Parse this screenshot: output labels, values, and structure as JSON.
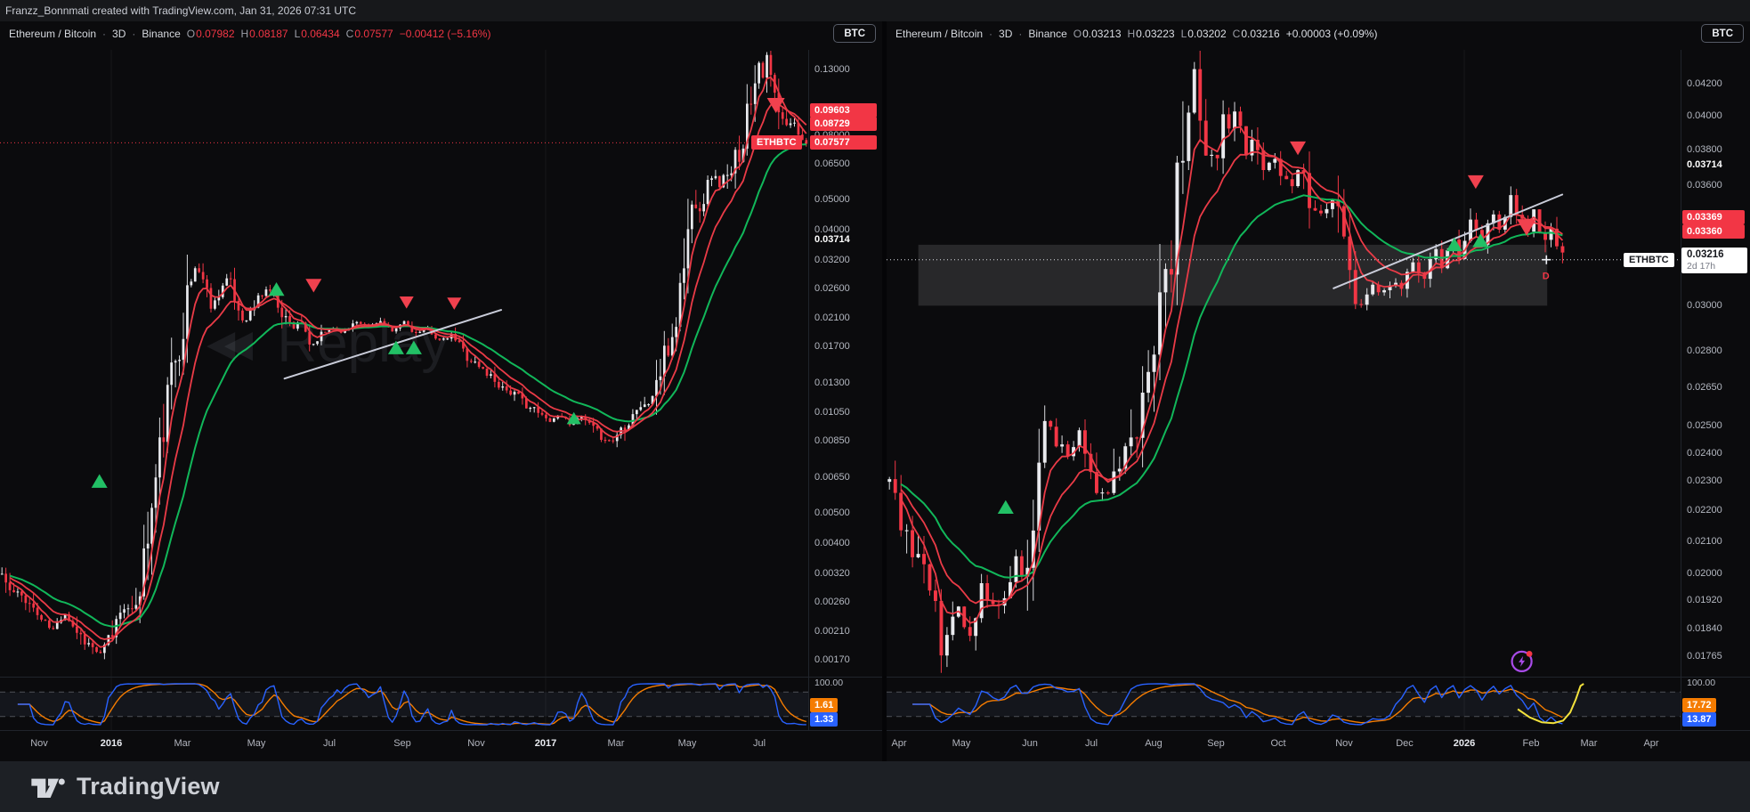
{
  "attribution": "Franzz_Bonnmati created with TradingView.com, Jan 31, 2026 07:31 UTC",
  "ui": {
    "dot": "·",
    "replay_icon": "◀◀"
  },
  "footer": {
    "brand": "TradingView"
  },
  "colors": {
    "red": "#f23645",
    "green_ma": "#11b75a",
    "red_ma": "#ea3b47",
    "up_candle": "#e9eaee",
    "blue": "#2962ff",
    "orange": "#f57c00",
    "yellow": "#f3e23c",
    "purple": "#a84be8",
    "trendline": "#c9ccd9",
    "white_tag_bg": "#ffffff"
  },
  "left_chart": {
    "legend": {
      "title": "Ethereum / Bitcoin",
      "interval": "3D",
      "exchange": "Binance",
      "items": [
        {
          "k": "O",
          "v": "0.07982"
        },
        {
          "k": "H",
          "v": "0.08187"
        },
        {
          "k": "L",
          "v": "0.06434"
        },
        {
          "k": "C",
          "v": "0.07577"
        }
      ],
      "change": "−0.00412 (−5.16%)"
    },
    "currency_button": "BTC",
    "watermark": "Replay",
    "price_scale": {
      "ticks": [
        {
          "label": "0.13000",
          "p": 0.13
        },
        {
          "label": "0.08000",
          "p": 0.08
        },
        {
          "label": "0.06500",
          "p": 0.065
        },
        {
          "label": "0.05000",
          "p": 0.05
        },
        {
          "label": "0.04000",
          "p": 0.04
        },
        {
          "label": "0.03200",
          "p": 0.032
        },
        {
          "label": "0.02600",
          "p": 0.026
        },
        {
          "label": "0.02100",
          "p": 0.021
        },
        {
          "label": "0.01700",
          "p": 0.017
        },
        {
          "label": "0.01300",
          "p": 0.013
        },
        {
          "label": "0.01050",
          "p": 0.0105
        },
        {
          "label": "0.00850",
          "p": 0.0085
        },
        {
          "label": "0.00650",
          "p": 0.0065
        },
        {
          "label": "0.00500",
          "p": 0.005
        },
        {
          "label": "0.00400",
          "p": 0.004
        },
        {
          "label": "0.00320",
          "p": 0.0032
        },
        {
          "label": "0.00260",
          "p": 0.0026
        },
        {
          "label": "0.00210",
          "p": 0.0021
        },
        {
          "label": "0.00170",
          "p": 0.0017
        }
      ],
      "bold_ticks": [
        {
          "label": "0.03714",
          "p": 0.03714
        }
      ]
    },
    "tags": [
      {
        "label": "0.09603",
        "p": 0.09603,
        "type": "red"
      },
      {
        "label": "0.08729",
        "p": 0.08729,
        "type": "red"
      },
      {
        "label": "0.07577",
        "p": 0.07577,
        "type": "red",
        "side_label": "ETHBTC"
      }
    ],
    "time_axis": [
      {
        "label": "Nov",
        "x": 44
      },
      {
        "label": "2016",
        "x": 125,
        "bold": true
      },
      {
        "label": "Mar",
        "x": 205
      },
      {
        "label": "May",
        "x": 288
      },
      {
        "label": "Jul",
        "x": 370
      },
      {
        "label": "Sep",
        "x": 452
      },
      {
        "label": "Nov",
        "x": 535
      },
      {
        "label": "2017",
        "x": 613,
        "bold": true
      },
      {
        "label": "Mar",
        "x": 692
      },
      {
        "label": "May",
        "x": 772
      },
      {
        "label": "Jul",
        "x": 853
      }
    ],
    "indicator": {
      "top_label": "100.00",
      "orange_value": "1.61",
      "blue_value": "1.33"
    },
    "chart_data": {
      "type": "candlestick",
      "symbol": "ETHBTC",
      "interval": "3D",
      "exchange": "Binance",
      "scale_type": "log",
      "ylim": [
        0.0015,
        0.15
      ],
      "candle_end": 1.0,
      "price_path": [
        [
          0,
          0.0033
        ],
        [
          0.012,
          0.0028
        ],
        [
          0.03,
          0.0027
        ],
        [
          0.05,
          0.0023
        ],
        [
          0.065,
          0.0021
        ],
        [
          0.08,
          0.0024
        ],
        [
          0.095,
          0.0021
        ],
        [
          0.11,
          0.0019
        ],
        [
          0.125,
          0.00175
        ],
        [
          0.14,
          0.0021
        ],
        [
          0.152,
          0.0026
        ],
        [
          0.163,
          0.0023
        ],
        [
          0.175,
          0.0032
        ],
        [
          0.185,
          0.0045
        ],
        [
          0.195,
          0.007
        ],
        [
          0.205,
          0.0105
        ],
        [
          0.215,
          0.015
        ],
        [
          0.225,
          0.0195
        ],
        [
          0.235,
          0.0265
        ],
        [
          0.243,
          0.031
        ],
        [
          0.252,
          0.0275
        ],
        [
          0.262,
          0.0225
        ],
        [
          0.272,
          0.0258
        ],
        [
          0.282,
          0.0282
        ],
        [
          0.292,
          0.0232
        ],
        [
          0.302,
          0.0202
        ],
        [
          0.312,
          0.0222
        ],
        [
          0.322,
          0.0246
        ],
        [
          0.332,
          0.0262
        ],
        [
          0.342,
          0.0242
        ],
        [
          0.352,
          0.0212
        ],
        [
          0.362,
          0.0196
        ],
        [
          0.372,
          0.021
        ],
        [
          0.382,
          0.0166
        ],
        [
          0.395,
          0.018
        ],
        [
          0.41,
          0.0196
        ],
        [
          0.425,
          0.0188
        ],
        [
          0.44,
          0.0206
        ],
        [
          0.455,
          0.0196
        ],
        [
          0.47,
          0.0205
        ],
        [
          0.485,
          0.0188
        ],
        [
          0.5,
          0.0204
        ],
        [
          0.515,
          0.0186
        ],
        [
          0.53,
          0.0194
        ],
        [
          0.545,
          0.0176
        ],
        [
          0.56,
          0.0184
        ],
        [
          0.575,
          0.0162
        ],
        [
          0.59,
          0.0148
        ],
        [
          0.605,
          0.0138
        ],
        [
          0.62,
          0.0127
        ],
        [
          0.635,
          0.012
        ],
        [
          0.65,
          0.0112
        ],
        [
          0.665,
          0.0104
        ],
        [
          0.68,
          0.0098
        ],
        [
          0.693,
          0.0103
        ],
        [
          0.706,
          0.0096
        ],
        [
          0.72,
          0.0101
        ],
        [
          0.733,
          0.0092
        ],
        [
          0.746,
          0.0087
        ],
        [
          0.757,
          0.0084
        ],
        [
          0.768,
          0.0093
        ],
        [
          0.78,
          0.0101
        ],
        [
          0.79,
          0.011
        ],
        [
          0.8,
          0.0108
        ],
        [
          0.81,
          0.0126
        ],
        [
          0.818,
          0.0142
        ],
        [
          0.826,
          0.0165
        ],
        [
          0.833,
          0.019
        ],
        [
          0.84,
          0.0238
        ],
        [
          0.847,
          0.033
        ],
        [
          0.854,
          0.0442
        ],
        [
          0.861,
          0.052
        ],
        [
          0.868,
          0.047
        ],
        [
          0.875,
          0.056
        ],
        [
          0.882,
          0.062
        ],
        [
          0.889,
          0.0543
        ],
        [
          0.896,
          0.0604
        ],
        [
          0.903,
          0.055
        ],
        [
          0.91,
          0.068
        ],
        [
          0.917,
          0.078
        ],
        [
          0.924,
          0.092
        ],
        [
          0.931,
          0.115
        ],
        [
          0.938,
          0.143
        ],
        [
          0.944,
          0.124
        ],
        [
          0.95,
          0.138
        ],
        [
          0.957,
          0.108
        ],
        [
          0.964,
          0.092
        ],
        [
          0.972,
          0.084
        ],
        [
          0.98,
          0.0895
        ],
        [
          0.988,
          0.082
        ],
        [
          1,
          0.0758
        ]
      ],
      "markers": [
        [
          0.123,
          0.0063,
          "up",
          9
        ],
        [
          0.342,
          0.0258,
          "up",
          9
        ],
        [
          0.388,
          0.0266,
          "down",
          9
        ],
        [
          0.503,
          0.0235,
          "down",
          8
        ],
        [
          0.562,
          0.0233,
          "down",
          8
        ],
        [
          0.49,
          0.0168,
          "up",
          9
        ],
        [
          0.512,
          0.0168,
          "up",
          9
        ],
        [
          0.71,
          0.01,
          "up",
          8
        ],
        [
          0.96,
          0.1,
          "down",
          10
        ]
      ],
      "trendline": {
        "t1": 0.352,
        "p1": 0.0134,
        "t2": 0.62,
        "p2": 0.0222
      },
      "current_price": {
        "p": 0.07577,
        "color": "#f23645"
      },
      "indicator": {
        "type": "stochastic",
        "range": [
          0,
          100
        ],
        "upper_band": 80,
        "lower_band": 20
      }
    }
  },
  "right_chart": {
    "legend": {
      "title": "Ethereum / Bitcoin",
      "interval": "3D",
      "exchange": "Binance",
      "items": [
        {
          "k": "O",
          "v": "0.03213"
        },
        {
          "k": "H",
          "v": "0.03223"
        },
        {
          "k": "L",
          "v": "0.03202"
        },
        {
          "k": "C",
          "v": "0.03216"
        }
      ],
      "change": "+0.00003 (+0.09%)"
    },
    "currency_button": "BTC",
    "price_scale": {
      "ticks": [
        {
          "label": "0.04200",
          "p": 0.042
        },
        {
          "label": "0.04000",
          "p": 0.04
        },
        {
          "label": "0.03800",
          "p": 0.038
        },
        {
          "label": "0.03600",
          "p": 0.036
        },
        {
          "label": "0.03000",
          "p": 0.03
        },
        {
          "label": "0.02800",
          "p": 0.028
        },
        {
          "label": "0.02650",
          "p": 0.0265
        },
        {
          "label": "0.02500",
          "p": 0.025
        },
        {
          "label": "0.02400",
          "p": 0.024
        },
        {
          "label": "0.02300",
          "p": 0.023
        },
        {
          "label": "0.02200",
          "p": 0.022
        },
        {
          "label": "0.02100",
          "p": 0.021
        },
        {
          "label": "0.02000",
          "p": 0.02
        },
        {
          "label": "0.01920",
          "p": 0.0192
        },
        {
          "label": "0.01840",
          "p": 0.0184
        },
        {
          "label": "0.01765",
          "p": 0.01765
        }
      ],
      "bold_ticks": [
        {
          "label": "0.03714",
          "p": 0.03714
        }
      ]
    },
    "tags": [
      {
        "label": "0.03369",
        "p": 0.03369,
        "type": "red",
        "dy": -13
      },
      {
        "label": "0.03360",
        "p": 0.0336,
        "type": "red",
        "dy": 1
      },
      {
        "label": "0.03216",
        "p": 0.03216,
        "type": "white",
        "side_label": "ETHBTC",
        "sub": "2d 17h"
      }
    ],
    "time_axis": [
      {
        "label": "Apr",
        "x": 14
      },
      {
        "label": "May",
        "x": 84
      },
      {
        "label": "Jun",
        "x": 161
      },
      {
        "label": "Jul",
        "x": 230
      },
      {
        "label": "Aug",
        "x": 300
      },
      {
        "label": "Sep",
        "x": 370
      },
      {
        "label": "Oct",
        "x": 440
      },
      {
        "label": "Nov",
        "x": 514
      },
      {
        "label": "Dec",
        "x": 582
      },
      {
        "label": "2026",
        "x": 649,
        "bold": true
      },
      {
        "label": "Feb",
        "x": 724
      },
      {
        "label": "Mar",
        "x": 789
      },
      {
        "label": "Apr",
        "x": 859
      }
    ],
    "indicator": {
      "top_label": "100.00",
      "orange_value": "17.72",
      "blue_value": "13.87"
    },
    "annotations": {
      "d_label": "D",
      "d_t": 0.826,
      "d_p": 0.0314,
      "sticker_t": 0.8,
      "sticker_p": 0.0175
    },
    "chart_data": {
      "type": "candlestick",
      "symbol": "ETHBTC",
      "interval": "3D",
      "exchange": "Binance",
      "scale_type": "log",
      "ylim": [
        0.0171,
        0.0442
      ],
      "candle_end": 0.855,
      "price_path": [
        [
          0,
          0.0232
        ],
        [
          0.02,
          0.0215
        ],
        [
          0.04,
          0.0205
        ],
        [
          0.055,
          0.0195
        ],
        [
          0.07,
          0.0177
        ],
        [
          0.09,
          0.019
        ],
        [
          0.105,
          0.0182
        ],
        [
          0.12,
          0.0195
        ],
        [
          0.14,
          0.0188
        ],
        [
          0.16,
          0.0205
        ],
        [
          0.175,
          0.02
        ],
        [
          0.19,
          0.0235
        ],
        [
          0.205,
          0.0252
        ],
        [
          0.225,
          0.0238
        ],
        [
          0.245,
          0.0247
        ],
        [
          0.26,
          0.0232
        ],
        [
          0.275,
          0.0222
        ],
        [
          0.29,
          0.0232
        ],
        [
          0.31,
          0.0245
        ],
        [
          0.33,
          0.027
        ],
        [
          0.35,
          0.031
        ],
        [
          0.365,
          0.035
        ],
        [
          0.378,
          0.04
        ],
        [
          0.388,
          0.0428
        ],
        [
          0.398,
          0.0392
        ],
        [
          0.412,
          0.037
        ],
        [
          0.425,
          0.0392
        ],
        [
          0.438,
          0.0405
        ],
        [
          0.452,
          0.0378
        ],
        [
          0.465,
          0.0388
        ],
        [
          0.478,
          0.0368
        ],
        [
          0.49,
          0.0375
        ],
        [
          0.505,
          0.0358
        ],
        [
          0.52,
          0.0368
        ],
        [
          0.535,
          0.0348
        ],
        [
          0.55,
          0.0342
        ],
        [
          0.562,
          0.0352
        ],
        [
          0.575,
          0.033
        ],
        [
          0.588,
          0.0308
        ],
        [
          0.6,
          0.03
        ],
        [
          0.612,
          0.0312
        ],
        [
          0.625,
          0.0304
        ],
        [
          0.638,
          0.0315
        ],
        [
          0.65,
          0.0308
        ],
        [
          0.662,
          0.032
        ],
        [
          0.675,
          0.0313
        ],
        [
          0.688,
          0.0327
        ],
        [
          0.7,
          0.0318
        ],
        [
          0.712,
          0.0331
        ],
        [
          0.724,
          0.0323
        ],
        [
          0.737,
          0.034
        ],
        [
          0.749,
          0.0331
        ],
        [
          0.762,
          0.0347
        ],
        [
          0.774,
          0.0338
        ],
        [
          0.786,
          0.0352
        ],
        [
          0.796,
          0.0344
        ],
        [
          0.806,
          0.0336
        ],
        [
          0.814,
          0.0346
        ],
        [
          0.822,
          0.0339
        ],
        [
          0.831,
          0.033
        ],
        [
          0.84,
          0.0336
        ],
        [
          0.848,
          0.0326
        ],
        [
          0.855,
          0.0322
        ]
      ],
      "markers": [
        [
          0.15,
          0.0221,
          "up",
          9
        ],
        [
          0.518,
          0.0381,
          "down",
          9
        ],
        [
          0.715,
          0.0329,
          "up",
          9
        ],
        [
          0.748,
          0.0331,
          "up",
          9
        ],
        [
          0.742,
          0.0362,
          "down",
          9
        ],
        [
          0.806,
          0.0338,
          "down",
          11
        ]
      ],
      "trendline": {
        "t1": 0.563,
        "p1": 0.0308,
        "t2": 0.851,
        "p2": 0.0355
      },
      "zone": {
        "t1": 0.04,
        "t2": 0.832,
        "p1": 0.03,
        "p2": 0.0329
      },
      "current_price": {
        "p": 0.03216,
        "color": "#dfe2e8",
        "cross_t": 0.831
      },
      "yellow_line": [
        [
          0.795,
          38
        ],
        [
          0.81,
          18
        ],
        [
          0.825,
          6
        ],
        [
          0.84,
          4
        ],
        [
          0.852,
          10
        ],
        [
          0.861,
          30
        ],
        [
          0.868,
          62
        ],
        [
          0.874,
          95
        ],
        [
          0.878,
          112
        ]
      ],
      "indicator": {
        "type": "stochastic",
        "range": [
          0,
          100
        ],
        "upper_band": 80,
        "lower_band": 20
      }
    }
  }
}
